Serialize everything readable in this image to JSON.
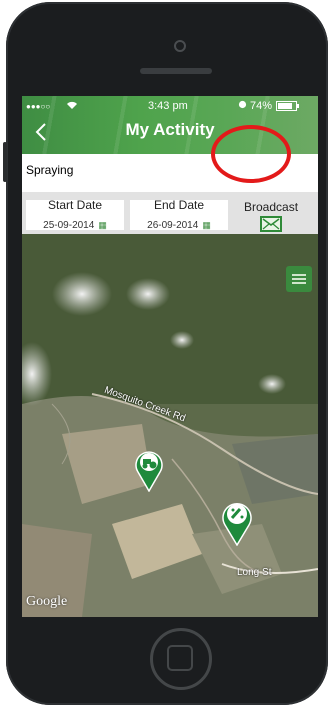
{
  "status_bar": {
    "signal": "●●●○○",
    "time": "3:43 pm",
    "battery": "74%"
  },
  "header": {
    "title": "My Activity"
  },
  "activity": {
    "name": "Spraying"
  },
  "dates": {
    "start_label": "Start Date",
    "start_value": "25-09-2014",
    "end_label": "End Date",
    "end_value": "26-09-2014"
  },
  "broadcast": {
    "label": "Broadcast"
  },
  "map": {
    "road_1": "Mosquito Creek Rd",
    "road_2": "Long St",
    "attribution": "Google"
  },
  "colors": {
    "brand_green": "#3d8c40",
    "annotation_red": "#e31a1a"
  }
}
